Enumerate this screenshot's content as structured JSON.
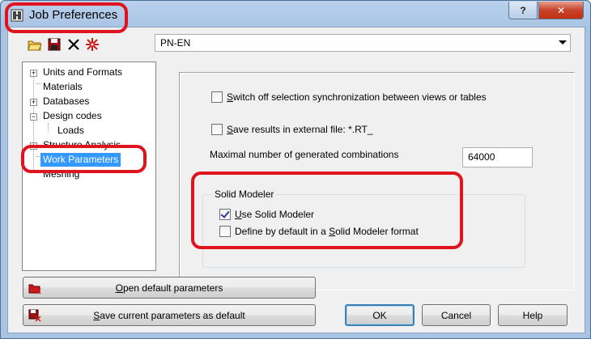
{
  "window": {
    "title": "Job Preferences",
    "help_glyph": "?",
    "close_glyph": "✕"
  },
  "toolbar": {
    "icons": [
      "open-folder-icon",
      "save-disk-icon",
      "delete-x-icon",
      "settings-star-icon"
    ],
    "code_combo": "PN-EN"
  },
  "tree": {
    "items": [
      {
        "label": "Units and Formats",
        "expander": "+"
      },
      {
        "label": "Materials",
        "expander": ""
      },
      {
        "label": "Databases",
        "expander": "+"
      },
      {
        "label": "Design codes",
        "expander": "−"
      },
      {
        "label": "Loads",
        "expander": ""
      },
      {
        "label": "Structure Analysis",
        "expander": "+"
      },
      {
        "label": "Work Parameters",
        "expander": ""
      },
      {
        "label": "Meshing",
        "expander": ""
      }
    ]
  },
  "options": {
    "switch_off_sync": {
      "label_first": "S",
      "label_rest": "witch off selection synchronization between views or tables",
      "checked": false
    },
    "save_results": {
      "label_first": "S",
      "label_rest": "ave results in external file: *.RT_",
      "checked": false
    },
    "max_combinations_label": "Maximal number of generated combinations",
    "max_combinations_value": "64000"
  },
  "solid_modeler": {
    "group_label": "Solid Modeler",
    "use": {
      "label_first": "U",
      "label_rest": "se Solid Modeler",
      "checked": true
    },
    "define_default": {
      "label_pre": "Define by default in a ",
      "label_ul": "S",
      "label_post": "olid Modeler format",
      "checked": false
    }
  },
  "buttons": {
    "open_default": {
      "ul": "O",
      "rest": "pen default parameters"
    },
    "save_current": {
      "ul": "S",
      "rest": "ave current parameters as default"
    },
    "ok": "OK",
    "cancel": "Cancel",
    "help": "Help"
  },
  "colors": {
    "annotation": "#e0141e",
    "selection": "#3399ff",
    "default_button_border": "#3c7fb1"
  }
}
